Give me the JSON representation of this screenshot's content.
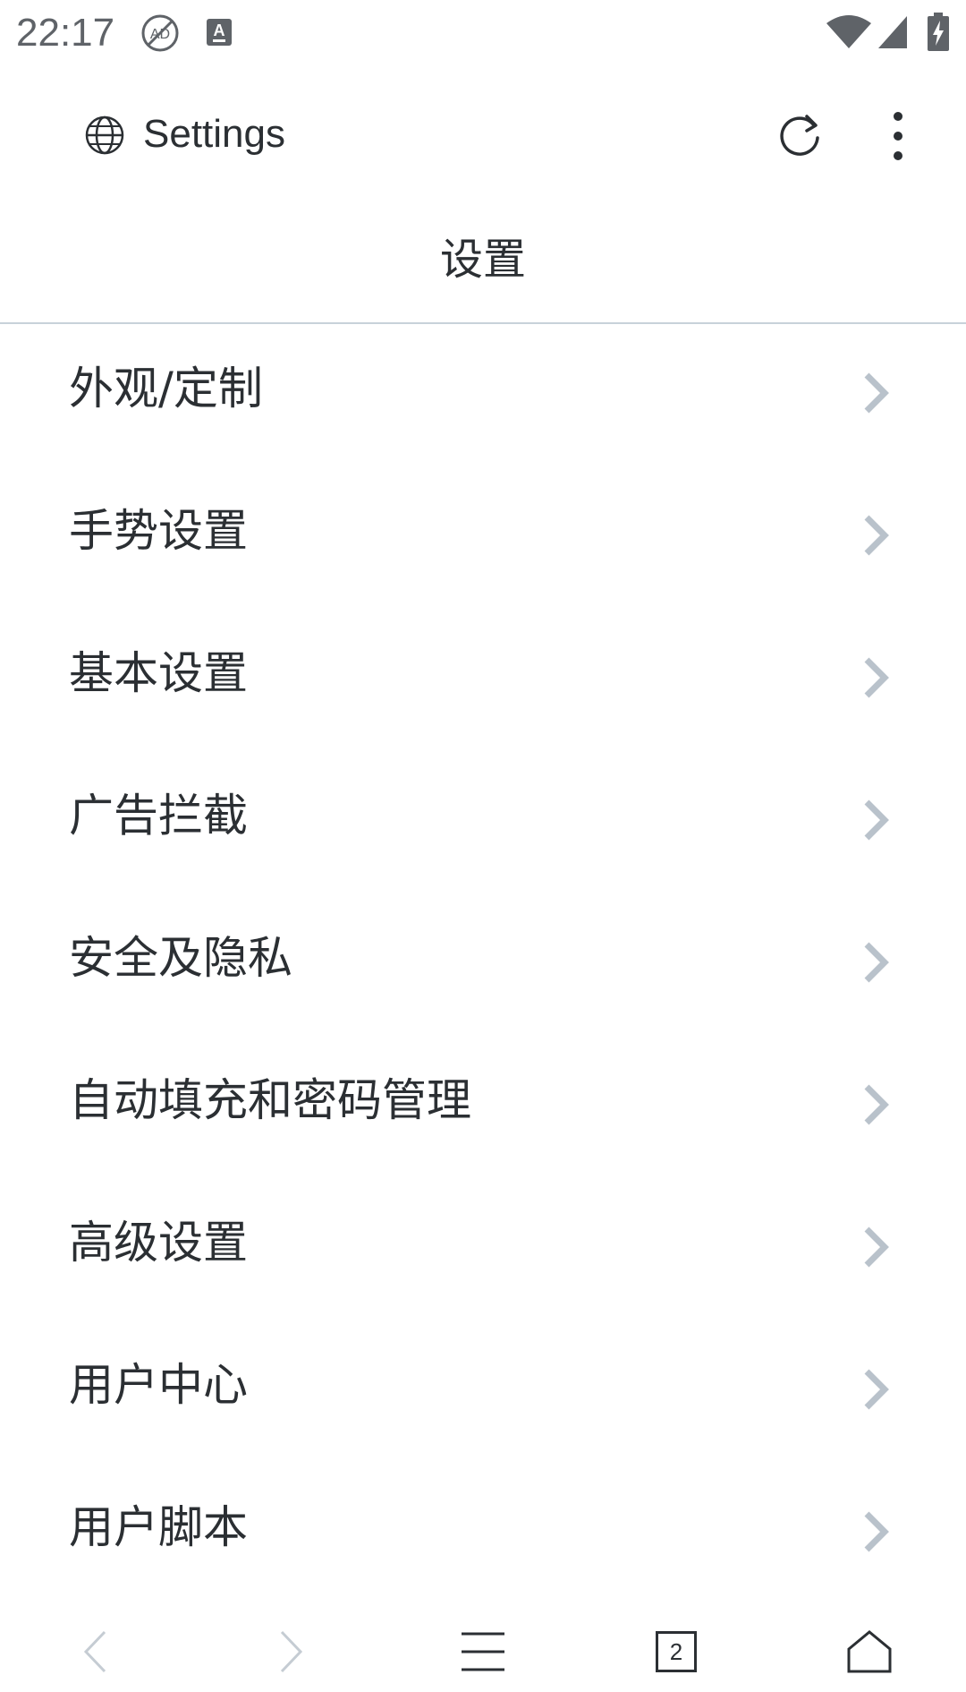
{
  "status_bar": {
    "time": "22:17",
    "icons": [
      "ad-block-icon",
      "keyboard-a-icon",
      "wifi-icon",
      "cellular-signal-icon",
      "battery-charging-icon"
    ]
  },
  "toolbar": {
    "site_icon": "globe-icon",
    "title": "Settings",
    "reload_icon": "reload-icon",
    "more_icon": "more-vertical-icon"
  },
  "page": {
    "title": "设置"
  },
  "settings": {
    "items": [
      {
        "label": "外观/定制",
        "icon": "chevron-right-icon"
      },
      {
        "label": "手势设置",
        "icon": "chevron-right-icon"
      },
      {
        "label": "基本设置",
        "icon": "chevron-right-icon"
      },
      {
        "label": "广告拦截",
        "icon": "chevron-right-icon"
      },
      {
        "label": "安全及隐私",
        "icon": "chevron-right-icon"
      },
      {
        "label": "自动填充和密码管理",
        "icon": "chevron-right-icon"
      },
      {
        "label": "高级设置",
        "icon": "chevron-right-icon"
      },
      {
        "label": "用户中心",
        "icon": "chevron-right-icon"
      },
      {
        "label": "用户脚本",
        "icon": "chevron-right-icon"
      }
    ]
  },
  "bottom_nav": {
    "tab_count": "2",
    "icons": [
      "back-icon",
      "forward-icon",
      "menu-icon",
      "tabs-icon",
      "home-icon"
    ]
  },
  "colors": {
    "text": "#2b2f33",
    "status_text": "#5f6368",
    "chevron": "#b9c2cb",
    "divider": "#c8d2da",
    "disabled": "#c5ccd3"
  }
}
